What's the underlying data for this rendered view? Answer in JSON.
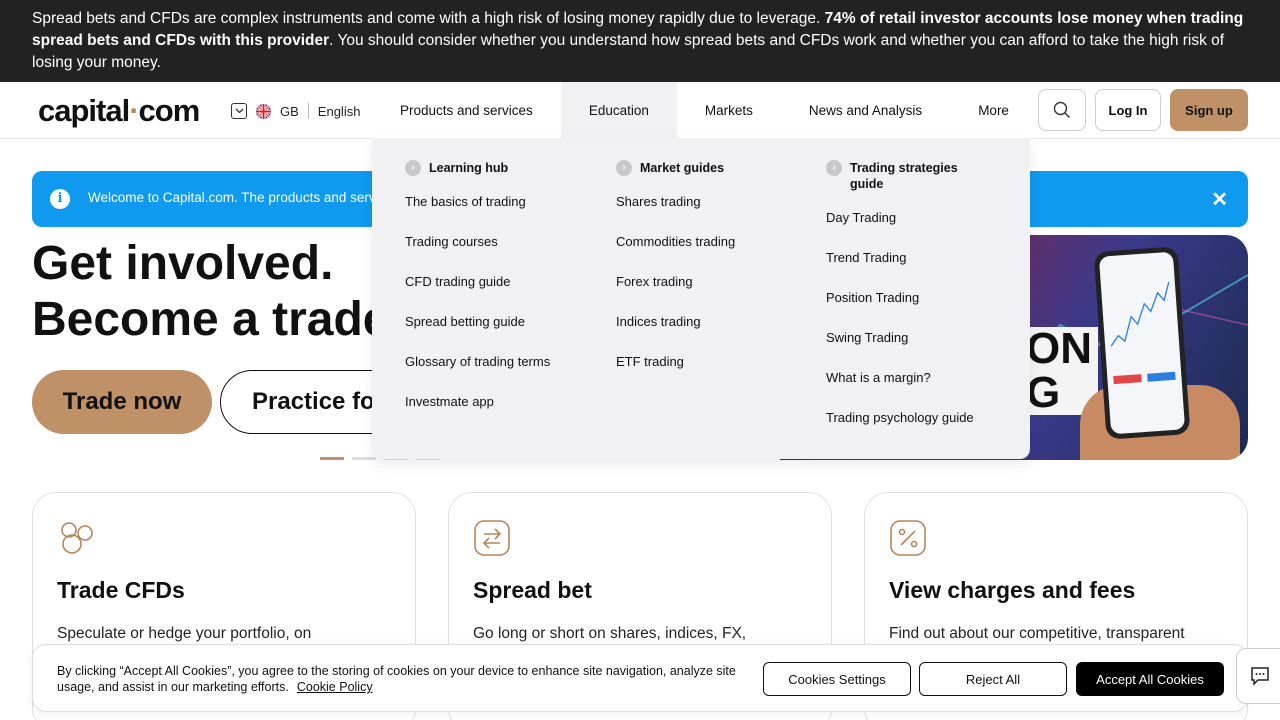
{
  "risk_banner": {
    "text_before": "Spread bets and CFDs are complex instruments and come with a high risk of losing money rapidly due to leverage. ",
    "bold": "74% of retail investor accounts lose money when trading spread bets and CFDs with this provider",
    "text_after": ". You should consider whether you understand how spread bets and CFDs work and whether you can afford to take the high risk of losing your money."
  },
  "header": {
    "logo_main": "capital",
    "logo_dot": "·",
    "logo_tail": "com",
    "region": "GB",
    "language": "English",
    "nav": [
      "Products and services",
      "Education",
      "Markets",
      "News and Analysis",
      "More"
    ],
    "login": "Log In",
    "signup": "Sign up"
  },
  "info_bar": {
    "text": "Welcome to Capital.com. The products and serv"
  },
  "hero": {
    "line1": "Get involved.",
    "line2": "Become a trade",
    "primary_button": "Trade now",
    "secondary_button": "Practice fo",
    "image_text": "ON\nG"
  },
  "mega_menu": {
    "columns": [
      {
        "title": "Learning hub",
        "links": [
          "The basics of trading",
          "Trading courses",
          "CFD trading guide",
          "Spread betting guide",
          "Glossary of trading terms",
          "Investmate app"
        ]
      },
      {
        "title": "Market guides",
        "links": [
          "Shares trading",
          "Commodities trading",
          "Forex trading",
          "Indices trading",
          "ETF trading"
        ]
      },
      {
        "title": "Trading strategies guide",
        "links": [
          "Day Trading",
          "Trend Trading",
          "Position Trading",
          "Swing Trading",
          "What is a margin?",
          "Trading psychology guide"
        ]
      }
    ]
  },
  "cards": [
    {
      "title": "Trade CFDs",
      "desc": "Speculate or hedge your portfolio, on"
    },
    {
      "title": "Spread bet",
      "desc": "Go long or short on shares, indices, FX,"
    },
    {
      "title": "View charges and fees",
      "desc": "Find out about our competitive, transparent"
    }
  ],
  "cookie": {
    "text": "By clicking “Accept All Cookies”, you agree to the storing of cookies on your device to enhance site navigation, analyze site usage, and assist in our marketing efforts.",
    "policy_link": "Cookie Policy",
    "settings": "Cookies Settings",
    "reject": "Reject All",
    "accept": "Accept All Cookies"
  },
  "colors": {
    "accent": "#c09166",
    "info_blue": "#0f9af0",
    "banner_bg": "#222222"
  },
  "icons": [
    "chevron-down-icon",
    "uk-flag-icon",
    "search-icon",
    "info-icon",
    "close-icon",
    "arrow-right-icon",
    "cfd-circles-icon",
    "spread-arrows-icon",
    "percent-icon",
    "chat-icon"
  ]
}
